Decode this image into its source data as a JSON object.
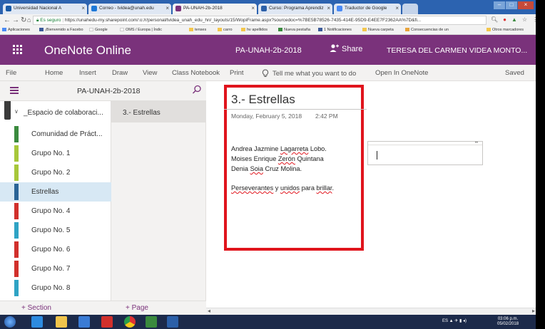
{
  "browser": {
    "tabs": [
      {
        "label": "Universidad Nacional A",
        "color": "#1a5aa6"
      },
      {
        "label": "Correo - tvidea@unah.edu",
        "color": "#1e78d7"
      },
      {
        "label": "PA-UNAH-2b-2018",
        "color": "#7a327b"
      },
      {
        "label": "Curso: Programa Aprendiz",
        "color": "#2b5fa8"
      },
      {
        "label": "Traductor de Google",
        "color": "#4a8af4"
      }
    ],
    "address": {
      "secure_label": "Es seguro",
      "url": "https://unahedu-my.sharepoint.com/:o:/r/personal/tvidea_unah_edu_hn/_layouts/15/WopiFrame.aspx?sourcedoc=%7BE5B78526-7435-414E-95D9-E4EE7F2362AA%7D&fi..."
    },
    "bookmarks": [
      "Aplicaciones",
      "¡Bienvenido a Facebo",
      "Google",
      "OMS / Europa | Índic",
      "tenses",
      "carro",
      "hv apellidos",
      "Nueva pestaña",
      "1 Notificaciones",
      "Nueva carpeta",
      "Consecuencias de un",
      "Otros marcadores"
    ]
  },
  "app": {
    "name": "OneNote Online",
    "notebook": "PA-UNAH-2b-2018",
    "share_label": "Share",
    "user": "TERESA DEL CARMEN VIDEA MONTO..."
  },
  "ribbon": {
    "file": "File",
    "home": "Home",
    "insert": "Insert",
    "draw": "Draw",
    "view": "View",
    "class_notebook": "Class Notebook",
    "print": "Print",
    "tell_me": "Tell me what you want to do",
    "open_in_onenote": "Open In OneNote",
    "status": "Saved"
  },
  "nav": {
    "notebook_title": "PA-UNAH-2b-2018",
    "section_group": "_Espacio de colaboraci...",
    "sections": [
      {
        "label": "Comunidad de Práct...",
        "color": "#3a8a3e"
      },
      {
        "label": "Grupo No. 1",
        "color": "#a7c73a"
      },
      {
        "label": "Grupo No. 2",
        "color": "#a7c73a"
      },
      {
        "label": "Estrellas",
        "color": "#2a6496"
      },
      {
        "label": "Grupo No. 4",
        "color": "#d1302c"
      },
      {
        "label": "Grupo No. 5",
        "color": "#2fa3c4"
      },
      {
        "label": "Grupo No. 6",
        "color": "#d1302c"
      },
      {
        "label": "Grupo No. 7",
        "color": "#d1302c"
      },
      {
        "label": "Grupo No. 8",
        "color": "#2fa3c4"
      }
    ],
    "pages": [
      "3.- Estrellas"
    ],
    "add_section": "+ Section",
    "add_page": "+ Page"
  },
  "page": {
    "title": "3.- Estrellas",
    "date": "Monday, February 5, 2018",
    "time": "2:42 PM",
    "lines": [
      {
        "pre": "Andrea Jazmine ",
        "sq": "Lagarreta",
        "post": " Lobo."
      },
      {
        "pre": "Moises Enrique ",
        "sq": "Zerón",
        "post": " Quintana"
      },
      {
        "pre": "Denia ",
        "sq": "Soia",
        "post": " Cruz Molina."
      }
    ],
    "motto": {
      "w1": "Perseverantes",
      "w2": " y ",
      "w3": "unidos",
      "w4": " para ",
      "w5": "brillar",
      "w6": "."
    }
  },
  "taskbar": {
    "tray": "ES",
    "time": "03:06 p.m.",
    "date": "05/02/2018"
  }
}
